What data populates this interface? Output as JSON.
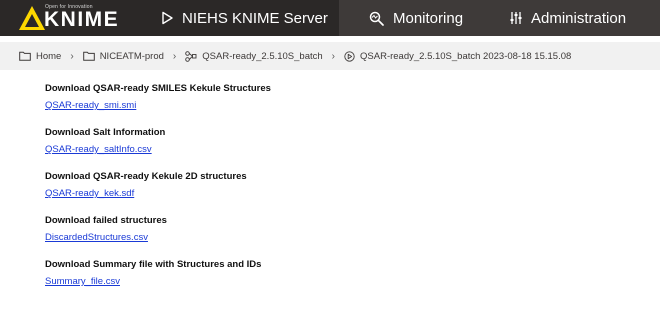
{
  "header": {
    "logo_tagline": "Open for Innovation",
    "logo_text": "KNIME",
    "nav": [
      {
        "label": "NIEHS KNIME Server",
        "icon": "play-icon"
      },
      {
        "label": "Monitoring",
        "icon": "monitoring-icon"
      },
      {
        "label": "Administration",
        "icon": "sliders-icon"
      }
    ]
  },
  "breadcrumb": [
    {
      "label": "Home",
      "icon": "folder-icon"
    },
    {
      "label": "NICEATM-prod",
      "icon": "folder-icon"
    },
    {
      "label": "QSAR-ready_2.5.10S_batch",
      "icon": "workflow-icon"
    },
    {
      "label": "QSAR-ready_2.5.10S_batch 2023-08-18 15.15.08",
      "icon": "job-icon"
    }
  ],
  "downloads": [
    {
      "title": "Download QSAR-ready SMILES Kekule Structures",
      "link": "QSAR-ready_smi.smi"
    },
    {
      "title": "Download Salt Information",
      "link": "QSAR-ready_saltInfo.csv"
    },
    {
      "title": "Download QSAR-ready Kekule 2D structures",
      "link": "QSAR-ready_kek.sdf"
    },
    {
      "title": "Download failed structures",
      "link": "DiscardedStructures.csv"
    },
    {
      "title": "Download Summary file with Structures and IDs",
      "link": "Summary_file.csv"
    }
  ],
  "colors": {
    "topbar": "#3e3a39",
    "logo_bg": "#2b2827",
    "accent": "#fdd800",
    "breadcrumb_bg": "#f1f1f1",
    "link": "#1a3ad6"
  }
}
